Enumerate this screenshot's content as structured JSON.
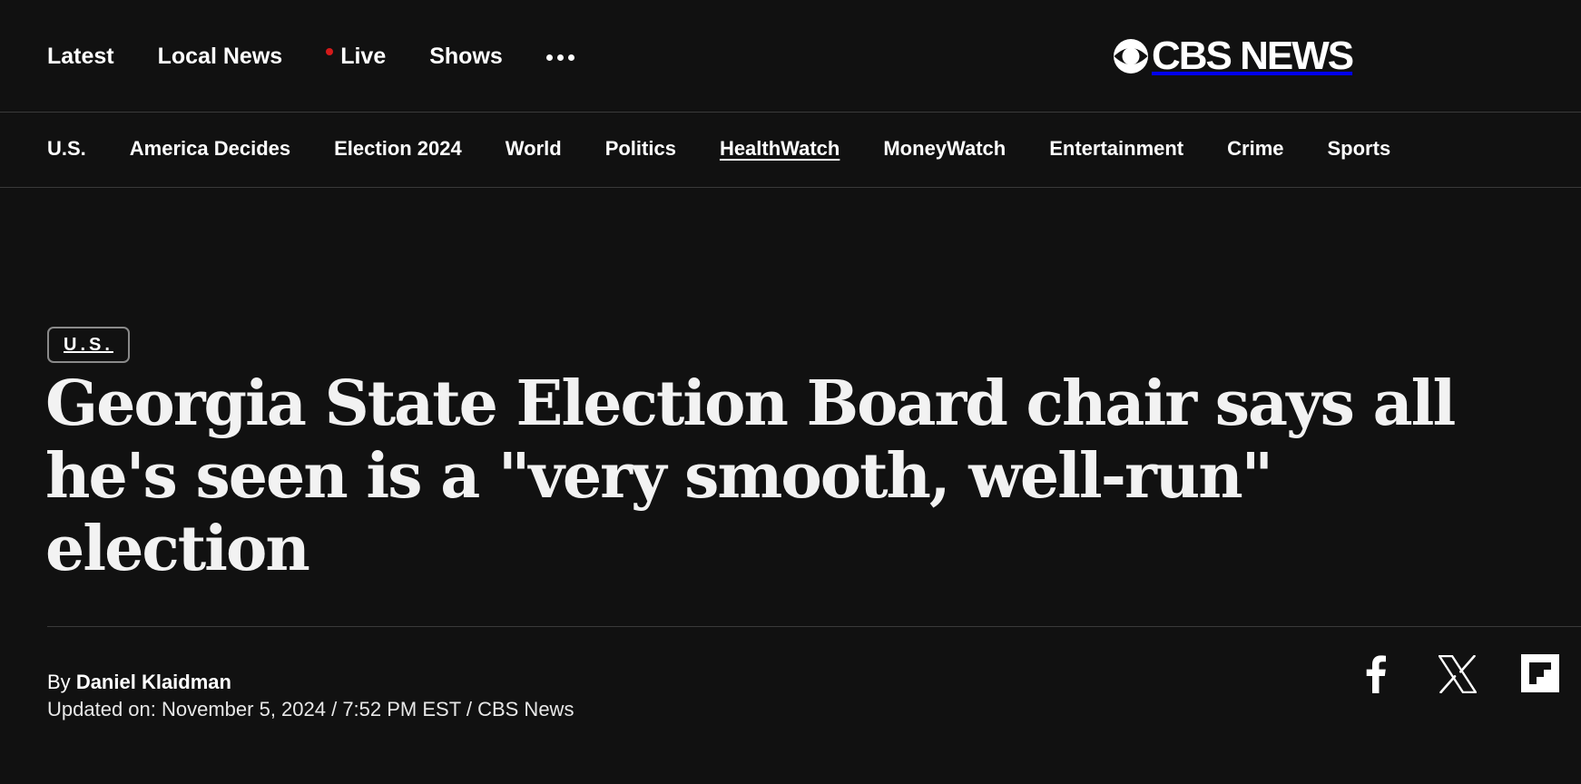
{
  "top_nav": {
    "latest": "Latest",
    "local_news": "Local News",
    "live": "Live",
    "shows": "Shows",
    "more_icon": "ellipsis-icon"
  },
  "logo": {
    "text": "CBS NEWS",
    "icon": "cbs-eye-icon"
  },
  "section_nav": {
    "items": [
      {
        "label": "U.S."
      },
      {
        "label": "America Decides"
      },
      {
        "label": "Election 2024"
      },
      {
        "label": "World"
      },
      {
        "label": "Politics"
      },
      {
        "label": "HealthWatch"
      },
      {
        "label": "MoneyWatch"
      },
      {
        "label": "Entertainment"
      },
      {
        "label": "Crime"
      },
      {
        "label": "Sports"
      }
    ],
    "active": "HealthWatch"
  },
  "article": {
    "category_tag": "U.S.",
    "headline": "Georgia State Election Board chair says all he's seen is a \"very smooth, well-run\" election",
    "by_prefix": "By",
    "author": "Daniel Klaidman",
    "updated": "Updated on: November 5, 2024 / 7:52 PM EST / CBS News"
  },
  "share": {
    "icons": [
      "facebook-icon",
      "x-icon",
      "flipboard-icon"
    ]
  },
  "colors": {
    "background": "#111111",
    "text": "#ffffff",
    "live_dot": "#d41a1a",
    "divider": "#3a3a3a"
  }
}
